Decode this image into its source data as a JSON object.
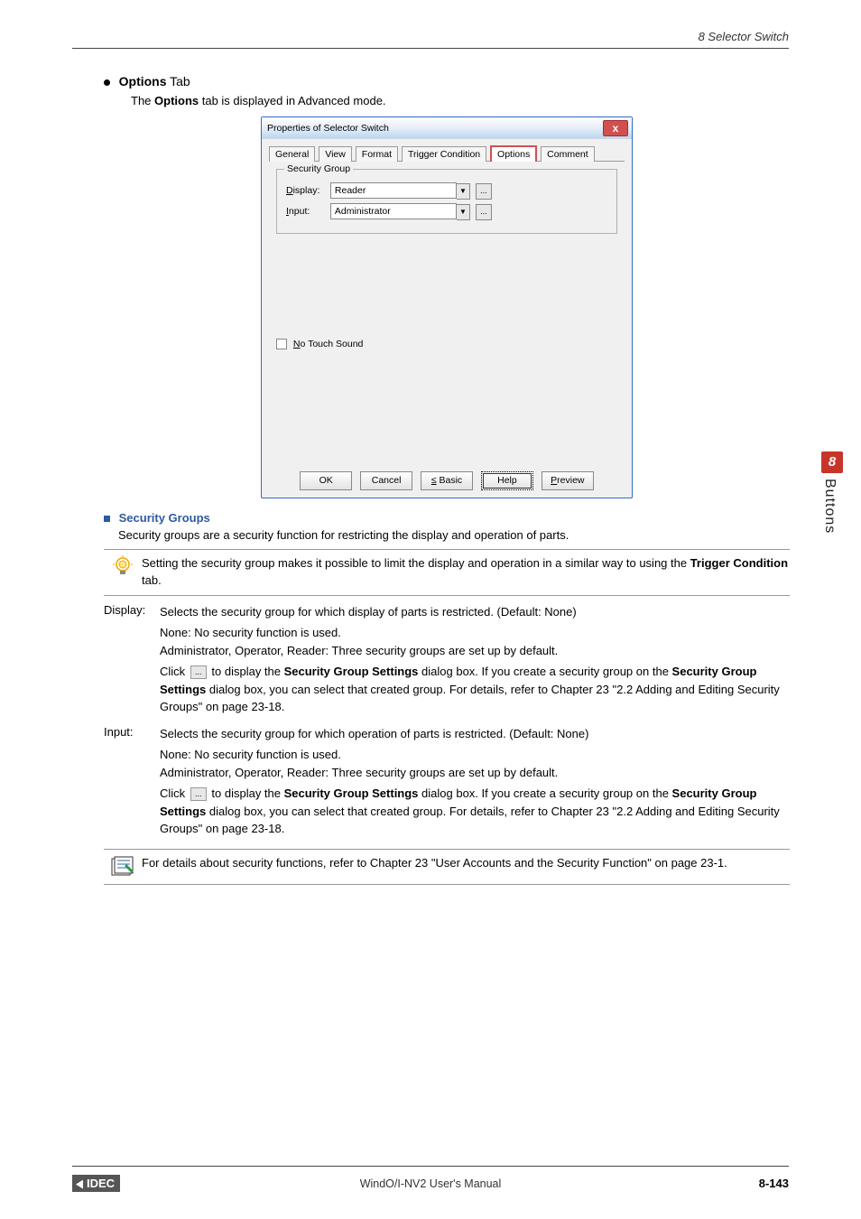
{
  "header": {
    "right": "8 Selector Switch"
  },
  "section": {
    "title_bold": "Options",
    "title_rest": " Tab",
    "intro_prefix": "The ",
    "intro_bold": "Options",
    "intro_suffix": " tab is displayed in Advanced mode."
  },
  "dialog": {
    "title": "Properties of Selector Switch",
    "tabs": [
      "General",
      "View",
      "Format",
      "Trigger Condition",
      "Options",
      "Comment"
    ],
    "active_tab_index": 4,
    "group_legend": "Security Group",
    "display_label": "Display:",
    "display_value": "Reader",
    "input_label": "Input:",
    "input_value": "Administrator",
    "no_touch": "No Touch Sound",
    "buttons": {
      "ok": "OK",
      "cancel": "Cancel",
      "basic": "≤ Basic",
      "help": "Help",
      "preview": "Preview"
    }
  },
  "security": {
    "heading": "Security Groups",
    "intro": "Security groups are a security function for restricting the display and operation of parts.",
    "lamp_prefix": "Setting the security group makes it possible to limit the display and operation in a similar way to using the ",
    "lamp_bold": "Trigger Condition",
    "lamp_suffix": " tab.",
    "display_label": "Display:",
    "display_p1": "Selects the security group for which display of parts is restricted. (Default: None)",
    "display_p2a": "None: No security function is used.",
    "display_p2b": "Administrator, Operator, Reader: Three security groups are set up by default.",
    "display_p3_prefix": "Click ",
    "display_p3_mid1": " to display the ",
    "display_p3_bold1": "Security Group Settings",
    "display_p3_mid2": " dialog box. If you create a security group on the ",
    "display_p3_bold2": "Security Group Settings",
    "display_p3_suffix": " dialog box, you can select that created group. For details, refer to Chapter 23 \"2.2 Adding and Editing Security Groups\" on page 23-18.",
    "input_label": "Input:",
    "input_p1": "Selects the security group for which operation of parts is restricted. (Default: None)",
    "input_p2a": "None: No security function is used.",
    "input_p2b": "Administrator, Operator, Reader: Three security groups are set up by default.",
    "input_p3_prefix": "Click ",
    "input_p3_mid1": " to display the ",
    "input_p3_bold1": "Security Group Settings",
    "input_p3_mid2": " dialog box. If you create a security group on the ",
    "input_p3_bold2": "Security Group Settings",
    "input_p3_suffix": " dialog box, you can select that created group. For details, refer to Chapter 23 \"2.2 Adding and Editing Security Groups\" on page 23-18.",
    "note": "For details about security functions, refer to Chapter 23 \"User Accounts and the Security Function\" on page 23-1."
  },
  "sidebar": {
    "num": "8",
    "label": "Buttons"
  },
  "footer": {
    "logo": "IDEC",
    "center": "WindO/I-NV2 User's Manual",
    "right": "8-143"
  }
}
